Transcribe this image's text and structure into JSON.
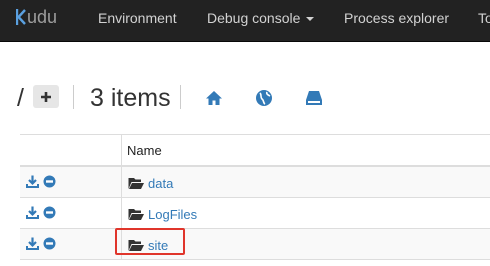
{
  "navbar": {
    "brand": "udu",
    "items": [
      {
        "label": "Environment"
      },
      {
        "label": "Debug console"
      },
      {
        "label": "Process explorer"
      },
      {
        "label": "To"
      }
    ]
  },
  "toolbar": {
    "path": "/",
    "add_label": "+",
    "items_count": "3 items",
    "icons": [
      "home-icon",
      "globe-icon",
      "drive-icon"
    ]
  },
  "table": {
    "header": {
      "name": "Name"
    },
    "rows": [
      {
        "name": "data",
        "type": "folder"
      },
      {
        "name": "LogFiles",
        "type": "folder"
      },
      {
        "name": "site",
        "type": "folder",
        "highlighted": true
      }
    ]
  },
  "colors": {
    "navbar_bg": "#222222",
    "link": "#337ab7",
    "icon_blue": "#337ab7",
    "highlight": "#e0352b"
  }
}
